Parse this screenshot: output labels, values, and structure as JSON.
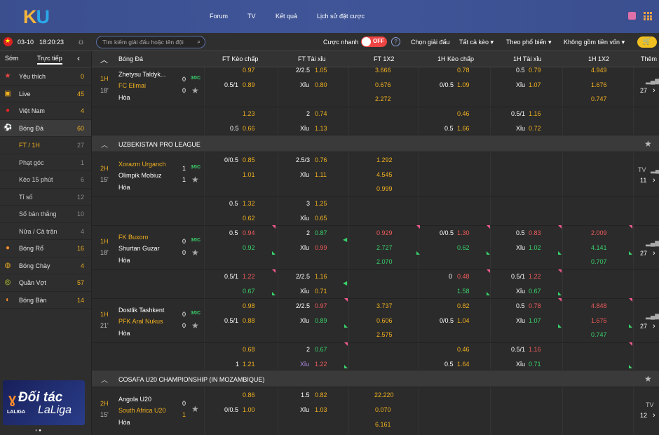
{
  "header": {
    "logo_k": "K",
    "logo_u": "U",
    "nav": [
      "Forum",
      "TV",
      "Kết quả",
      "Lịch sử đặt cược"
    ]
  },
  "toolbar": {
    "date": "03-10",
    "time": "18:20:23",
    "search_placeholder": "Tìm kiếm giải đấu hoặc tên đội",
    "quick_bet": "Cược nhanh",
    "toggle": "OFF",
    "help": "?",
    "league_select": "Chọn giải đấu",
    "all_odds": "Tất cả kèo",
    "popular": "Theo phổ biến",
    "no_capital": "Không gồm tiền vốn"
  },
  "sidebar": {
    "tabs": [
      "Sớm",
      "Trực tiếp"
    ],
    "items": [
      {
        "label": "Yêu thích",
        "count": "0",
        "icon": "★"
      },
      {
        "label": "Live",
        "count": "45",
        "icon": "▣"
      },
      {
        "label": "Việt Nam",
        "count": "4",
        "icon": "●"
      },
      {
        "label": "Bóng Đá",
        "count": "60",
        "icon": "⚽"
      },
      {
        "label": "FT / 1H",
        "count": "27"
      },
      {
        "label": "Phạt góc",
        "count": "1"
      },
      {
        "label": "Kèo 15 phút",
        "count": "6"
      },
      {
        "label": "Tỉ số",
        "count": "12"
      },
      {
        "label": "Số bàn thắng",
        "count": "10"
      },
      {
        "label": "Nửa / Cả trận",
        "count": "4"
      },
      {
        "label": "Bóng Rổ",
        "count": "16",
        "icon": "●"
      },
      {
        "label": "Bóng Chày",
        "count": "4",
        "icon": "◍"
      },
      {
        "label": "Quần Vợt",
        "count": "57",
        "icon": "◎"
      },
      {
        "label": "Bóng Bàn",
        "count": "14",
        "icon": "◐"
      }
    ],
    "banner": {
      "title": "Đối tác",
      "brand": "LaLiga",
      "tag": "LALIGA"
    }
  },
  "columns": [
    "Bóng Đá",
    "FT Kèo chấp",
    "FT Tài xỉu",
    "FT 1X2",
    "1H Kèo chấp",
    "1H Tài xỉu",
    "1H 1X2",
    "Thêm"
  ],
  "matches": {
    "m1": {
      "period": "1H",
      "minute": "18'",
      "home": "Zhetysu Taldyk...",
      "away": "FC Elimai",
      "draw": "Hòa",
      "hs": "0",
      "as": "0",
      "more": "27",
      "r1": [
        "0.97",
        "2/2.5",
        "1.05",
        "3.666",
        "0.78",
        "0.5",
        "0.79",
        "4.949"
      ],
      "r2": [
        "0.5/1",
        "0.89",
        "Xỉu",
        "0.80",
        "0.676",
        "0/0.5",
        "1.09",
        "Xỉu",
        "1.07",
        "1.676"
      ],
      "r3": [
        "2.272",
        "0.747"
      ],
      "e1": [
        "1.23",
        "2",
        "0.74",
        "0.46",
        "0.5/1",
        "1.16"
      ],
      "e2": [
        "0.5",
        "0.66",
        "Xỉu",
        "1.13",
        "0.5",
        "1.66",
        "Xỉu",
        "0.72"
      ]
    },
    "l1": "UZBEKISTAN PRO LEAGUE",
    "m2": {
      "period": "2H",
      "minute": "15'",
      "home": "Xorazm Urganch",
      "away": "Olimpik Mobiuz",
      "draw": "Hòa",
      "hs": "1",
      "as": "1",
      "more": "11",
      "tv": "TV",
      "r1": [
        "0/0.5",
        "0.85",
        "2.5/3",
        "0.76",
        "1.292"
      ],
      "r2": [
        "1.01",
        "Xỉu",
        "1.11",
        "4.545"
      ],
      "r3": [
        "0.999"
      ],
      "e1": [
        "0.5",
        "1.32",
        "3",
        "1.25"
      ],
      "e2": [
        "0.62",
        "Xỉu",
        "0.65"
      ]
    },
    "m3": {
      "period": "1H",
      "minute": "18'",
      "home": "FK Buxoro",
      "away": "Shurtan Guzar",
      "draw": "Hòa",
      "hs": "0",
      "as": "0",
      "more": "27",
      "r1": [
        "0.5",
        "0.94",
        "2",
        "0.87",
        "0.929",
        "0/0.5",
        "1.30",
        "0.5",
        "0.83",
        "2.009"
      ],
      "r2": [
        "0.92",
        "Xỉu",
        "0.99",
        "2.727",
        "0.62",
        "Xỉu",
        "1.02",
        "4.141"
      ],
      "r3": [
        "2.070",
        "0.707"
      ],
      "e1": [
        "0.5/1",
        "1.22",
        "2/2.5",
        "1.16",
        "0",
        "0.48",
        "0.5/1",
        "1.22"
      ],
      "e2": [
        "0.67",
        "Xỉu",
        "0.71",
        "1.58",
        "Xỉu",
        "0.67"
      ]
    },
    "m4": {
      "period": "1H",
      "minute": "21'",
      "home": "Dostlik Tashkent",
      "away": "PFK Aral Nukus",
      "draw": "Hòa",
      "hs": "0",
      "as": "0",
      "more": "27",
      "r1": [
        "0.98",
        "2/2.5",
        "0.97",
        "3.737",
        "0.82",
        "0.5",
        "0.78",
        "4.848"
      ],
      "r2": [
        "0.5/1",
        "0.88",
        "Xỉu",
        "0.89",
        "0.606",
        "0/0.5",
        "1.04",
        "Xỉu",
        "1.07",
        "1.676"
      ],
      "r3": [
        "2.575",
        "0.747"
      ],
      "e1": [
        "0.68",
        "2",
        "0.67",
        "0.46",
        "0.5/1",
        "1.16"
      ],
      "e2": [
        "1",
        "1.21",
        "Xỉu",
        "1.22",
        "0.5",
        "1.64",
        "Xỉu",
        "0.71"
      ]
    },
    "l2": "COSAFA U20 CHAMPIONSHIP (IN MOZAMBIQUE)",
    "m5": {
      "period": "2H",
      "minute": "15'",
      "home": "Angola U20",
      "away": "South Africa U20",
      "draw": "Hòa",
      "hs": "0",
      "as": "1",
      "more": "12",
      "tv": "TV",
      "r1": [
        "0.86",
        "1.5",
        "0.82",
        "22.220"
      ],
      "r2": [
        "0/0.5",
        "1.00",
        "Xỉu",
        "1.03",
        "0.070"
      ],
      "r3": [
        "6.161"
      ]
    }
  },
  "more_label": "Thêm"
}
